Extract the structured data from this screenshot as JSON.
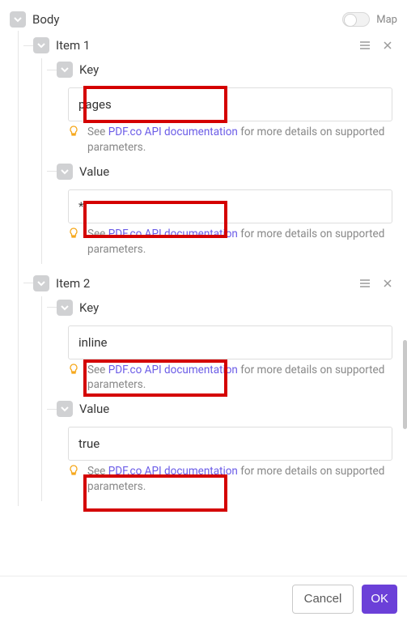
{
  "body": {
    "label": "Body",
    "map_label": "Map"
  },
  "items": [
    {
      "title": "Item 1",
      "key_label": "Key",
      "key_value": "pages",
      "value_label": "Value",
      "value_value": "*"
    },
    {
      "title": "Item 2",
      "key_label": "Key",
      "key_value": "inline",
      "value_label": "Value",
      "value_value": "true"
    }
  ],
  "hint": {
    "prefix": "See ",
    "link_text": "PDF.co API documentation",
    "suffix": " for more details on supported parameters."
  },
  "footer": {
    "cancel": "Cancel",
    "ok": "OK"
  }
}
